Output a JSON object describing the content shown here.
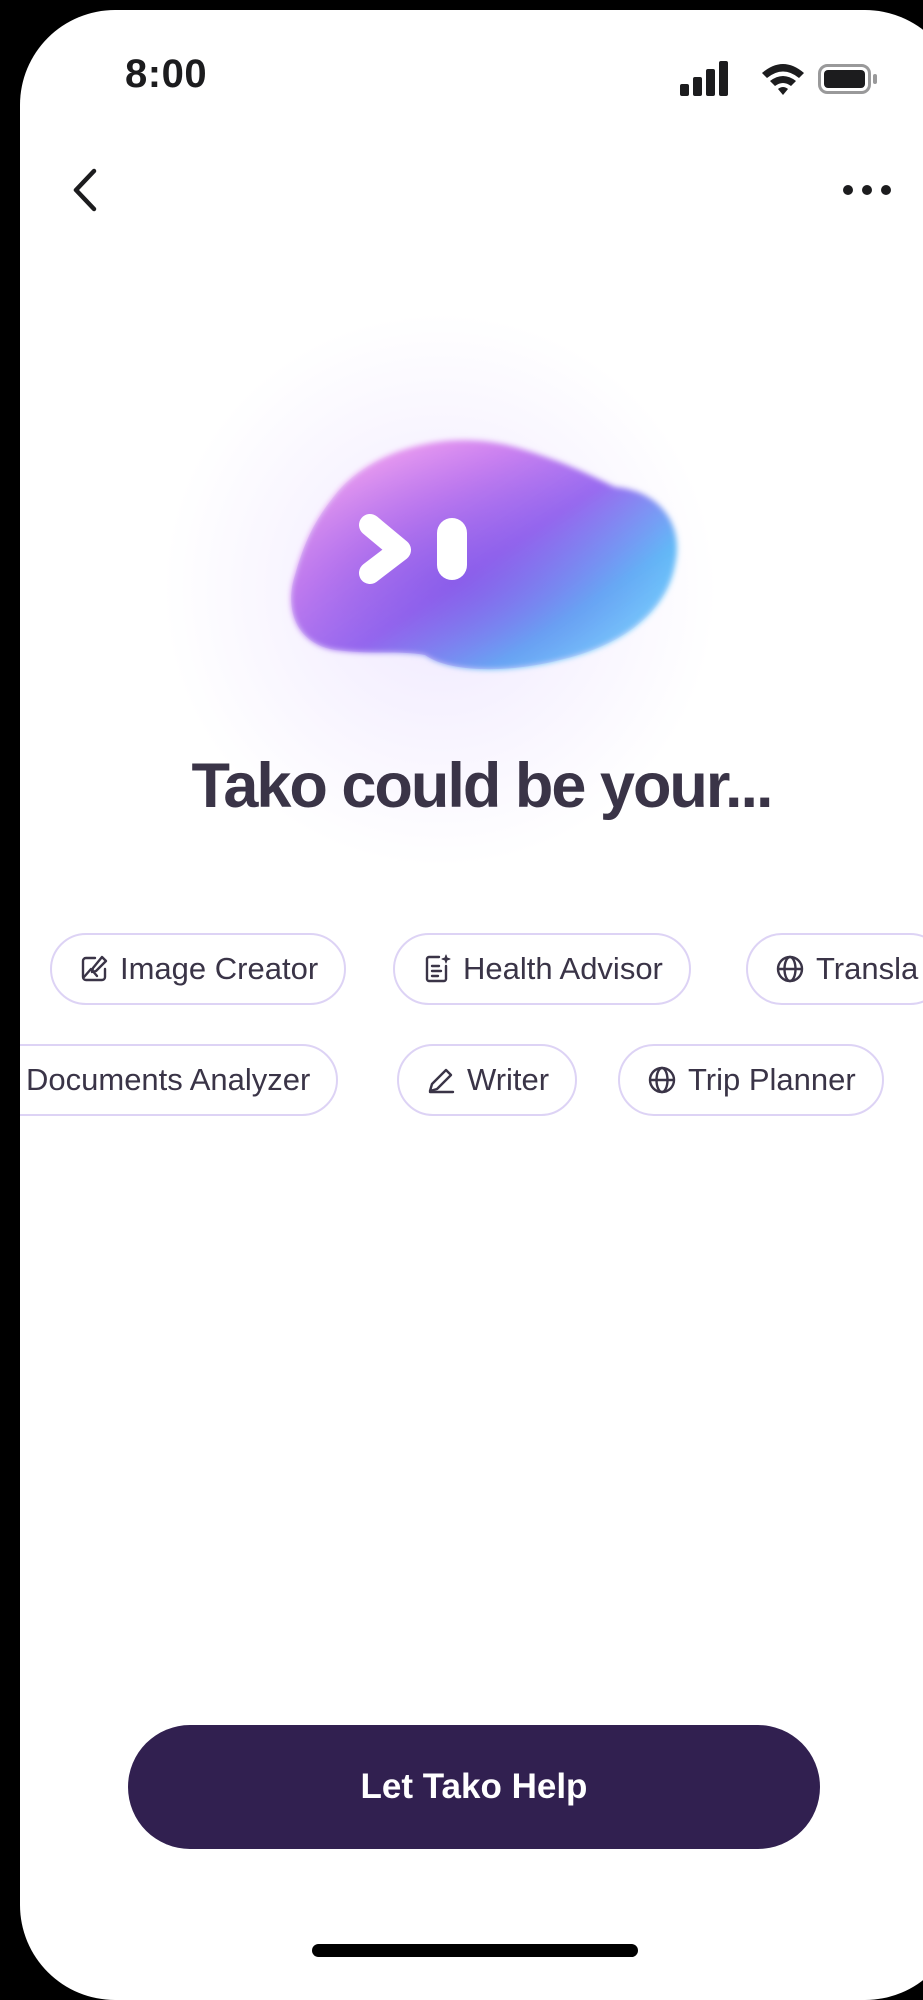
{
  "status_bar": {
    "time": "8:00",
    "icons": [
      "cellular-signal-icon",
      "wifi-icon",
      "battery-icon"
    ]
  },
  "nav": {
    "back_icon": "chevron-left-icon",
    "more_icon": "ellipsis-icon"
  },
  "hero": {
    "mascot_icon": "tako-blob-mascot-icon",
    "headline": "Tako could be your..."
  },
  "chips_row_1": [
    {
      "label": "Image Creator",
      "icon": "image-edit-icon"
    },
    {
      "label": "Health Advisor",
      "icon": "document-sparkle-icon"
    },
    {
      "label": "Transla",
      "icon": "globe-icon"
    }
  ],
  "chips_row_2": [
    {
      "label": "Documents Analyzer",
      "icon": "document-icon"
    },
    {
      "label": "Writer",
      "icon": "pen-icon"
    },
    {
      "label": "Trip Planner",
      "icon": "globe-icon"
    }
  ],
  "cta": {
    "label": "Let Tako Help"
  },
  "colors": {
    "cta_background": "#312050",
    "headline_text": "#3a3447",
    "chip_border": "#ddd3f5"
  }
}
